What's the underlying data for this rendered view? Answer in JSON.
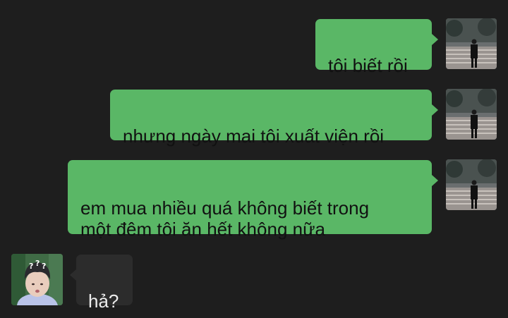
{
  "messages": [
    {
      "direction": "outgoing",
      "text": "tôi biết rồi",
      "avatar": "user-avatar"
    },
    {
      "direction": "outgoing",
      "text": "nhưng ngày mai tôi xuất viện rồi",
      "avatar": "user-avatar"
    },
    {
      "direction": "outgoing",
      "text": "em mua nhiều quá không biết trong\nmột đêm tôi ăn hết không nữa",
      "avatar": "user-avatar"
    },
    {
      "direction": "incoming",
      "text": "hả?",
      "avatar": "contact-avatar"
    }
  ],
  "colors": {
    "background": "#1e1e1e",
    "outgoing_bubble": "#5ab766",
    "incoming_bubble": "#2c2c2c"
  }
}
